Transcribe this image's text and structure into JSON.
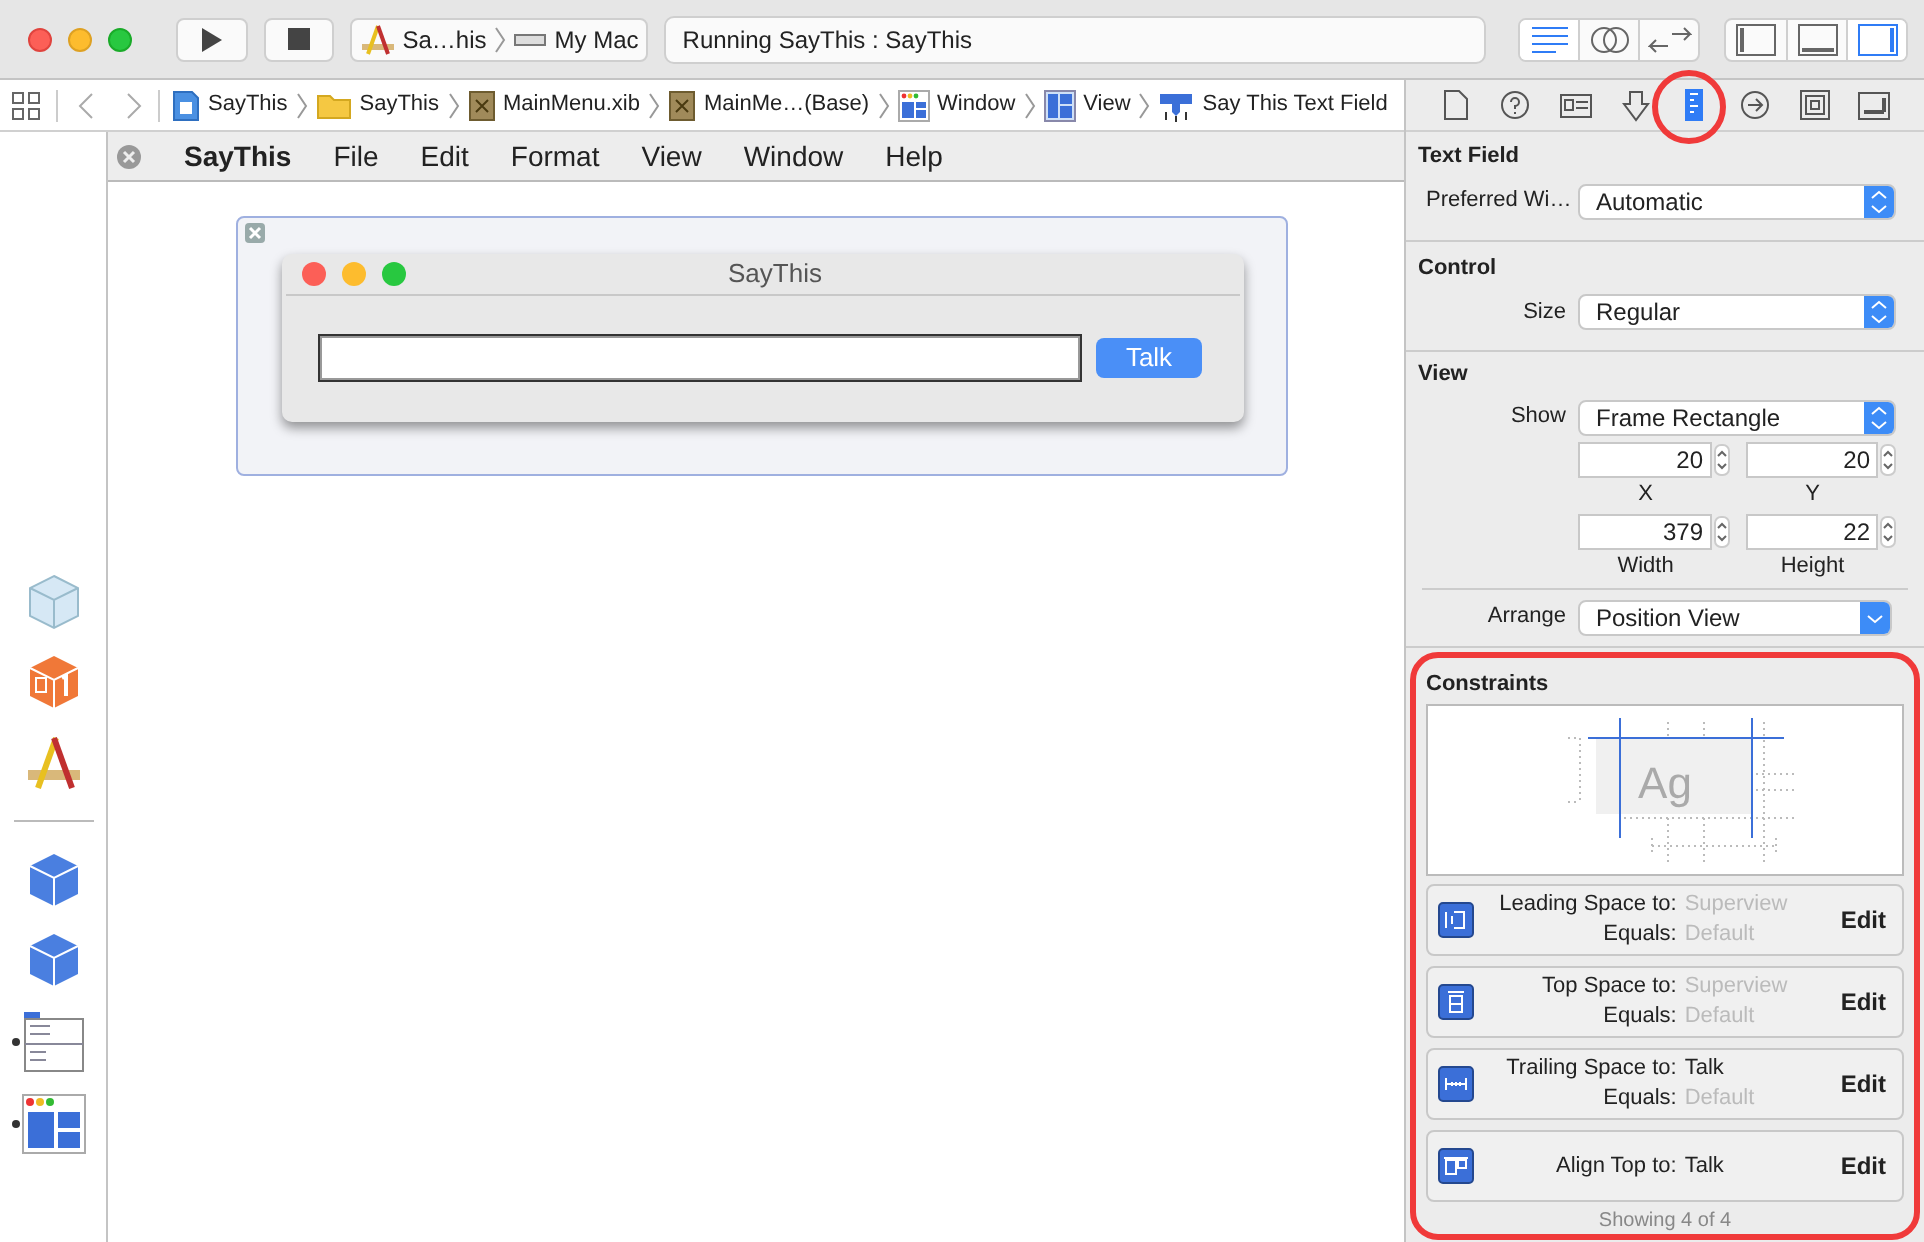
{
  "toolbar": {
    "scheme": {
      "target": "Sa…his",
      "device": "My Mac"
    },
    "status": "Running SayThis : SayThis",
    "editor_modes": [
      {
        "kind": "standard",
        "selected": true
      },
      {
        "kind": "assistant",
        "selected": false
      },
      {
        "kind": "version",
        "selected": false
      }
    ],
    "panels": [
      {
        "kind": "navigator",
        "selected": false
      },
      {
        "kind": "debug",
        "selected": false
      },
      {
        "kind": "utilities",
        "selected": true
      }
    ]
  },
  "breadcrumbs": [
    {
      "kind": "project",
      "label": "SayThis"
    },
    {
      "kind": "folder",
      "label": "SayThis"
    },
    {
      "kind": "xib",
      "label": "MainMenu.xib"
    },
    {
      "kind": "xib",
      "label": "MainMe…(Base)"
    },
    {
      "kind": "window",
      "label": "Window"
    },
    {
      "kind": "view",
      "label": "View"
    },
    {
      "kind": "textfield",
      "label": "Say This Text Field"
    }
  ],
  "outline": [
    {
      "kind": "placeholder",
      "marked": false
    },
    {
      "kind": "first-responder",
      "marked": false
    },
    {
      "kind": "application",
      "marked": false
    },
    {
      "kind": "divider",
      "marked": false
    },
    {
      "kind": "object",
      "marked": false
    },
    {
      "kind": "object",
      "marked": false
    },
    {
      "kind": "menu",
      "marked": true
    },
    {
      "kind": "window",
      "marked": true
    }
  ],
  "menu_bar": {
    "app": "SayThis",
    "items": [
      "File",
      "Edit",
      "Format",
      "View",
      "Window",
      "Help"
    ]
  },
  "canvas_window": {
    "title": "SayThis",
    "button": "Talk"
  },
  "inspector_tabs": [
    {
      "kind": "file",
      "selected": false
    },
    {
      "kind": "help",
      "selected": false
    },
    {
      "kind": "identity",
      "selected": false
    },
    {
      "kind": "attributes",
      "selected": false
    },
    {
      "kind": "size",
      "selected": true
    },
    {
      "kind": "connections",
      "selected": false
    },
    {
      "kind": "bindings",
      "selected": false
    },
    {
      "kind": "effects",
      "selected": false
    }
  ],
  "text_field_section": {
    "title": "Text Field",
    "label": "Preferred Wi…",
    "value": "Automatic"
  },
  "control_section": {
    "title": "Control",
    "label": "Size",
    "value": "Regular"
  },
  "view_section": {
    "title": "View",
    "show_label": "Show",
    "show_value": "Frame Rectangle",
    "fields": [
      {
        "value": "20",
        "label": "X"
      },
      {
        "value": "20",
        "label": "Y"
      },
      {
        "value": "379",
        "label": "Width"
      },
      {
        "value": "22",
        "label": "Height"
      }
    ],
    "arrange_label": "Arrange",
    "arrange_value": "Position View"
  },
  "constraints": {
    "title": "Constraints",
    "preview": "Ag",
    "items": [
      {
        "kind": "leading",
        "label": "Leading Space to:",
        "target": "Superview",
        "target_dim": true,
        "equals_label": "Equals:",
        "equals": "Default",
        "action": "Edit"
      },
      {
        "kind": "top",
        "label": "Top Space to:",
        "target": "Superview",
        "target_dim": true,
        "equals_label": "Equals:",
        "equals": "Default",
        "action": "Edit"
      },
      {
        "kind": "trailing",
        "label": "Trailing Space to:",
        "target": "Talk",
        "target_dim": false,
        "equals_label": "Equals:",
        "equals": "Default",
        "action": "Edit"
      },
      {
        "kind": "align",
        "label": "Align Top to:",
        "target": "Talk",
        "target_dim": false,
        "action": "Edit"
      }
    ],
    "footer": "Showing 4 of 4"
  }
}
